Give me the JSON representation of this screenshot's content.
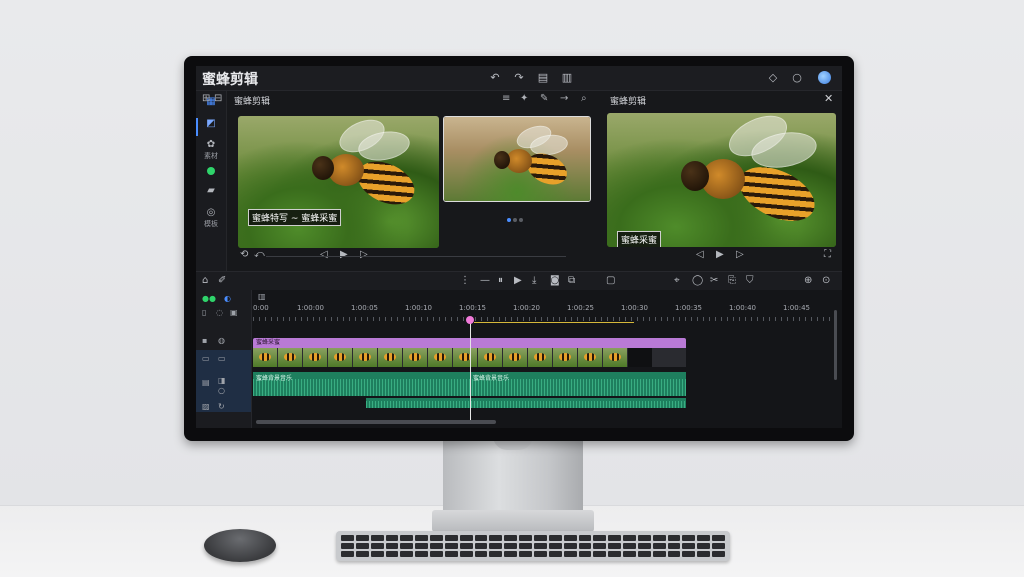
{
  "app": {
    "title": "蜜蜂剪辑"
  },
  "titlebar": {
    "icons": [
      "undo-icon",
      "redo-icon",
      "export-icon",
      "share-icon",
      "notification-icon",
      "chat-icon"
    ]
  },
  "rail": {
    "items": [
      {
        "glyph": "▦",
        "label": ""
      },
      {
        "glyph": "✿",
        "label": "素材"
      },
      {
        "glyph": "",
        "label": ""
      },
      {
        "glyph": "▰",
        "label": ""
      },
      {
        "glyph": "◎",
        "label": "模板"
      }
    ]
  },
  "source": {
    "title": "蜜蜂剪辑",
    "caption": "蜜蜂特写 ~ 蜜蜂采蜜",
    "controls": {
      "prev": "◁",
      "play": "▶",
      "next": "▷"
    }
  },
  "program": {
    "title": "蜜蜂剪辑",
    "caption": "蜜蜂采蜜",
    "controls": {
      "play": "▶"
    }
  },
  "timeline": {
    "ticks": [
      "0:00",
      "1:00:00",
      "1:00:05",
      "1:00:10",
      "1:00:15",
      "1:00:20",
      "1:00:25",
      "1:00:30",
      "1:00:35",
      "1:00:40",
      "1:00:45"
    ],
    "video_track_label": "蜜蜂采蜜",
    "audio_track_label_a": "蜜蜂背景音乐",
    "audio_track_label_b": "蜜蜂背景音乐"
  },
  "colors": {
    "accent": "#4a8dff",
    "video_track": "#b97ad6",
    "audio_track": "#1e7f5e",
    "playhead": "#f07ad9"
  }
}
